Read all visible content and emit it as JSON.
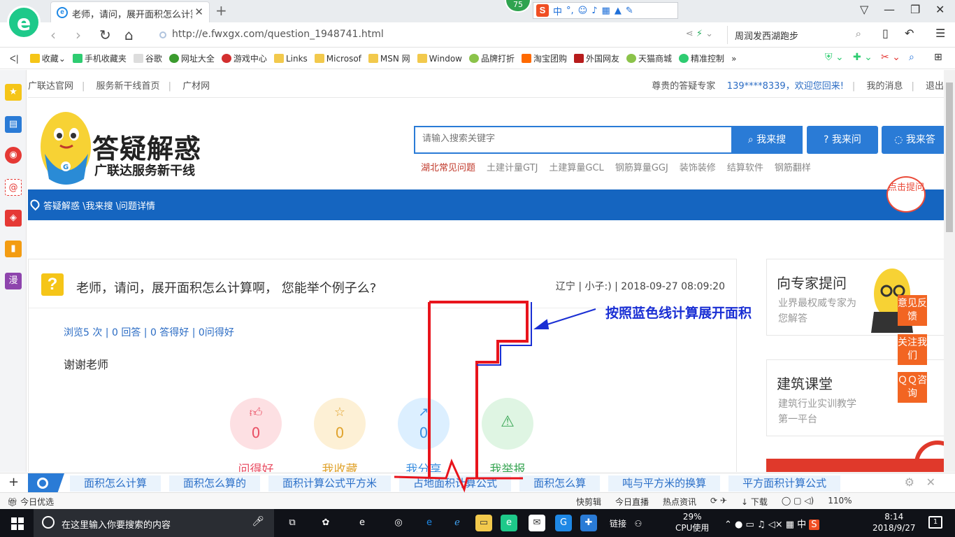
{
  "browser": {
    "tab_title": "老师，请问，展开面积怎么计算啊",
    "logo_letter": "e",
    "badge": "75",
    "ime_label": "中",
    "url": "http://e.fwxgx.com/question_1948741.html",
    "search_text": "周润发西湖跑步",
    "bookmarks": [
      "收藏",
      "手机收藏夹",
      "谷歌",
      "网址大全",
      "游戏中心",
      "Links",
      "Microsof",
      "MSN 网",
      "Window",
      "品牌打折",
      "淘宝团购",
      "外国网友",
      "天猫商城",
      "精准控制"
    ]
  },
  "site": {
    "topnav_left": [
      "广联达官网",
      "服务新干线首页",
      "广材网"
    ],
    "greeting": "尊贵的答疑专家",
    "user": "139****8339，欢迎您回来!",
    "messages": "我的消息",
    "logout": "退出",
    "brand": "答疑解惑",
    "brand_sub": "广联达服务新干线",
    "search_placeholder": "请输入搜索关键字",
    "btn_search": "我来搜",
    "btn_ask": "我来问",
    "btn_answer": "我来答",
    "hot_links": [
      "湖北常见问题",
      "土建计量GTJ",
      "土建算量GCL",
      "钢筋算量GGJ",
      "装饰装修",
      "结算软件",
      "钢筋翻样"
    ],
    "breadcrumb": "答疑解惑 \\我来搜 \\问题详情"
  },
  "question": {
    "title": "老师，请问，展开面积怎么计算啊， 您能举个例子么?",
    "meta": "辽宁 | 小子:) | 2018-09-27 08:09:20",
    "stats": "浏览5 次 | 0 回答 | 0 答得好 | 0问得好",
    "body": "谢谢老师",
    "actions": [
      {
        "label": "问得好",
        "count": "0"
      },
      {
        "label": "我收藏",
        "count": "0"
      },
      {
        "label": "我分享",
        "count": "0"
      },
      {
        "label": "我举报",
        "count": ""
      }
    ]
  },
  "aside": {
    "expert_title": "向专家提问",
    "expert_sub": "业界最权威专家为您解答",
    "class_title": "建筑课堂",
    "class_sub": "建筑行业实训教学第一平台",
    "bubble": "点击提问",
    "float_buttons": [
      "意见反馈",
      "关注我们",
      "ＱＱ咨询"
    ]
  },
  "annotation": {
    "text": "按照蓝色线计算展开面积",
    "red_color": "#e8141c",
    "blue_color": "#1a2fd4"
  },
  "hotbar": {
    "chips": [
      "面积怎么计算",
      "面积怎么算的",
      "面积计算公式平方米",
      "占地面积计算公式",
      "面积怎么算",
      "吨与平方米的换算",
      "平方面积计算公式"
    ]
  },
  "statusbar": {
    "left": "今日优选",
    "items": [
      "快剪辑",
      "今日直播",
      "热点资讯",
      "下载",
      "110%"
    ]
  },
  "taskbar": {
    "search_placeholder": "在这里输入你要搜索的内容",
    "links": "链接",
    "cpu_pct": "29%",
    "cpu_label": "CPU使用",
    "ime": "中",
    "time": "8:14",
    "date": "2018/9/27",
    "notif": "1"
  }
}
